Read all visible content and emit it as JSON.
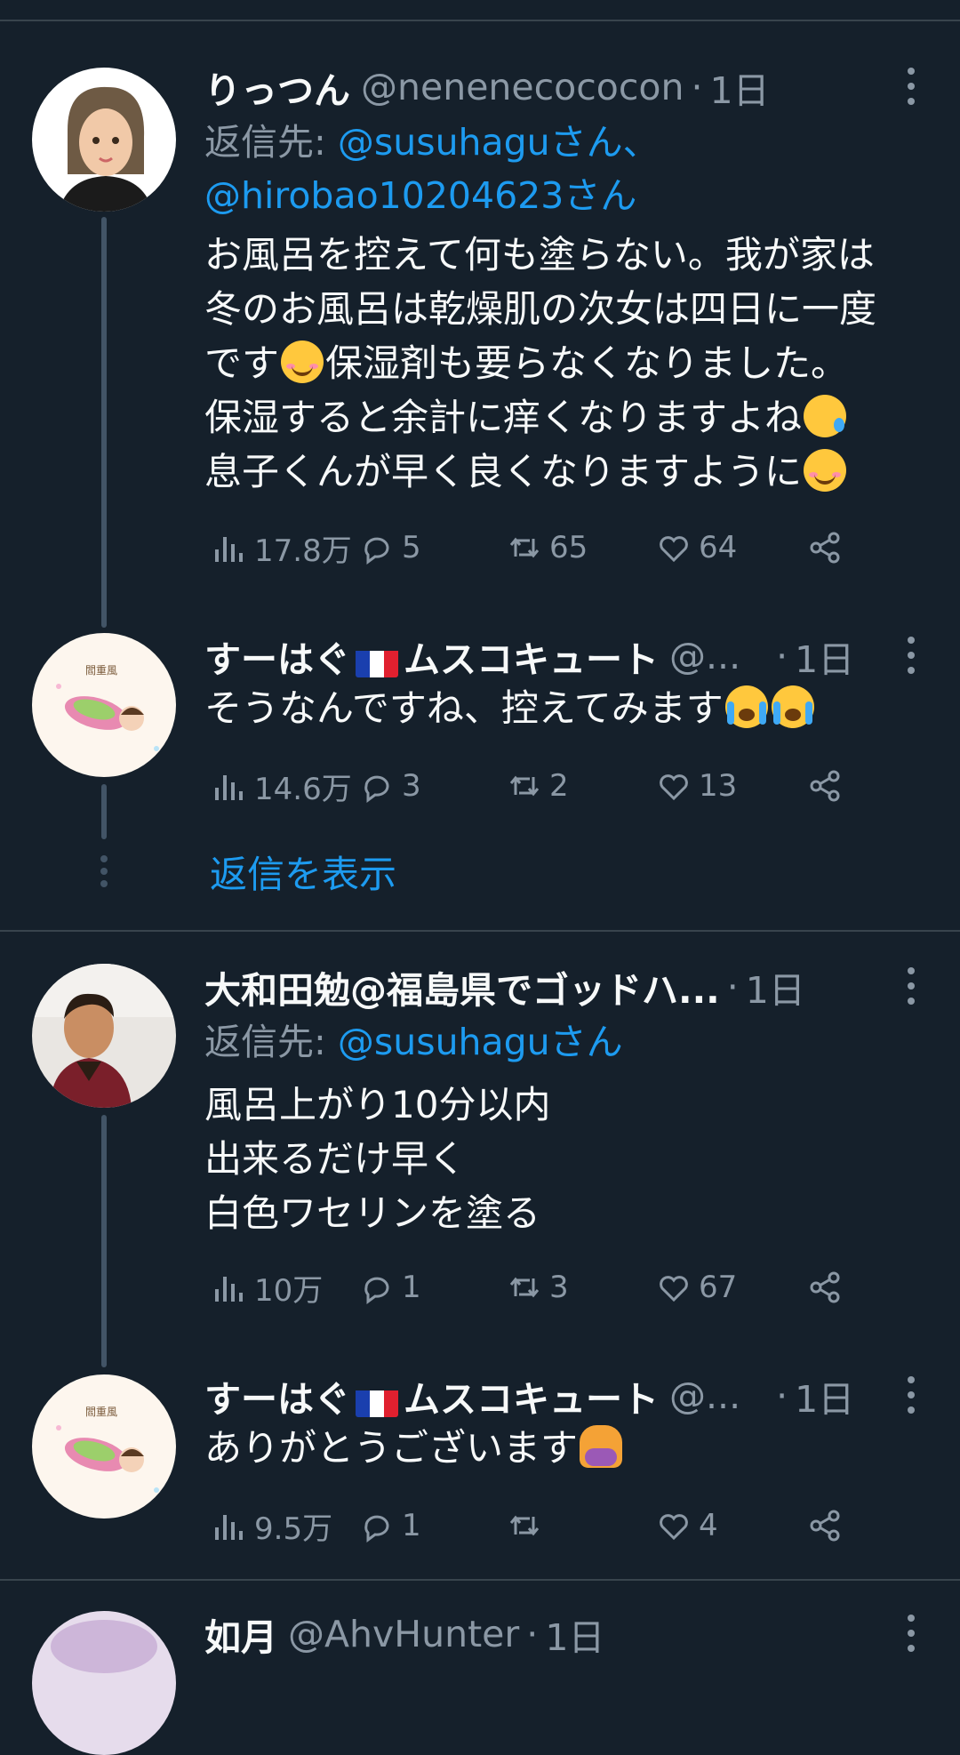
{
  "tweets": [
    {
      "name": "りっつん",
      "handle": "@nenenecococon",
      "time": "1日",
      "reply_prefix": "返信先: ",
      "reply_to_1": "@susuhaguさん、",
      "reply_to_2": "@hirobao10204623さん",
      "text_lines": [
        "お風呂を控えて何も塗らない。我が家は",
        "冬のお風呂は乾燥肌の次女は四日に一度",
        "です",
        "保湿剤も要らなくなりました。",
        "保湿すると余計に痒くなりますよね",
        "息子くんが早く良くなりますように"
      ],
      "views": "17.8万",
      "replies": "5",
      "retweets": "65",
      "likes": "64"
    },
    {
      "name_a": "すーはぐ",
      "name_b": "ムスコキュート",
      "handle": "@...",
      "time": "1日",
      "text": "そうなんですね、控えてみます",
      "views": "14.6万",
      "replies": "3",
      "retweets": "2",
      "likes": "13",
      "show_replies": "返信を表示"
    },
    {
      "name": "大和田勉@福島県でゴッドハ...",
      "time": "1日",
      "reply_prefix": "返信先: ",
      "reply_to_1": "@susuhaguさん",
      "text_lines": [
        "風呂上がり10分以内",
        "出来るだけ早く",
        "白色ワセリンを塗る"
      ],
      "views": "10万",
      "replies": "1",
      "retweets": "3",
      "likes": "67"
    },
    {
      "name_a": "すーはぐ",
      "name_b": "ムスコキュート",
      "handle": "@...",
      "time": "1日",
      "text": "ありがとうございます",
      "views": "9.5万",
      "replies": "1",
      "retweets": "",
      "likes": "4"
    },
    {
      "name": "如月",
      "handle": "@AhvHunter",
      "time": "1日"
    }
  ],
  "colors": {
    "bg": "#15202b",
    "link": "#1d9bf0",
    "muted": "#8b98a5",
    "divider": "#38444d"
  },
  "icons": [
    "views-icon",
    "reply-icon",
    "retweet-icon",
    "like-icon",
    "share-icon",
    "more-icon"
  ]
}
